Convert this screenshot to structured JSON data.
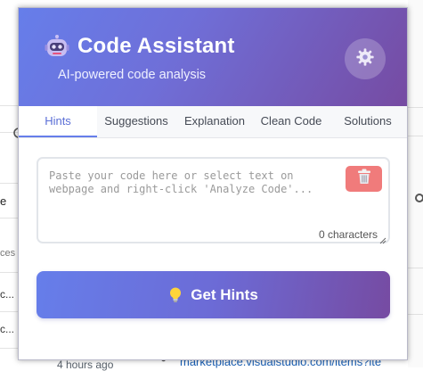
{
  "background": {
    "fragments": [
      "e",
      "ces a",
      "c...",
      "c...",
      "4 hours ago"
    ],
    "bottom_link": "marketplace.visualstudio.com/items?ite"
  },
  "popup": {
    "title": "Code Assistant",
    "subtitle": "AI-powered code analysis",
    "tabs": [
      {
        "label": "Hints",
        "active": true
      },
      {
        "label": "Suggestions",
        "active": false
      },
      {
        "label": "Explanation",
        "active": false
      },
      {
        "label": "Clean Code",
        "active": false
      },
      {
        "label": "Solutions",
        "active": false
      }
    ],
    "editor": {
      "value": "",
      "placeholder": "Paste your code here or select text on webpage and right-click 'Analyze Code'...",
      "char_count": "0 characters"
    },
    "action_button": {
      "label": "Get Hints"
    }
  },
  "icons": {
    "logo": "robot-icon",
    "settings": "gear-icon",
    "clear": "trash-icon",
    "action": "lightbulb-icon"
  },
  "colors": {
    "gradient_start": "#667eea",
    "gradient_end": "#764ba2",
    "active_tab": "#5b6fd6",
    "clear_button": "#f07b7b"
  }
}
